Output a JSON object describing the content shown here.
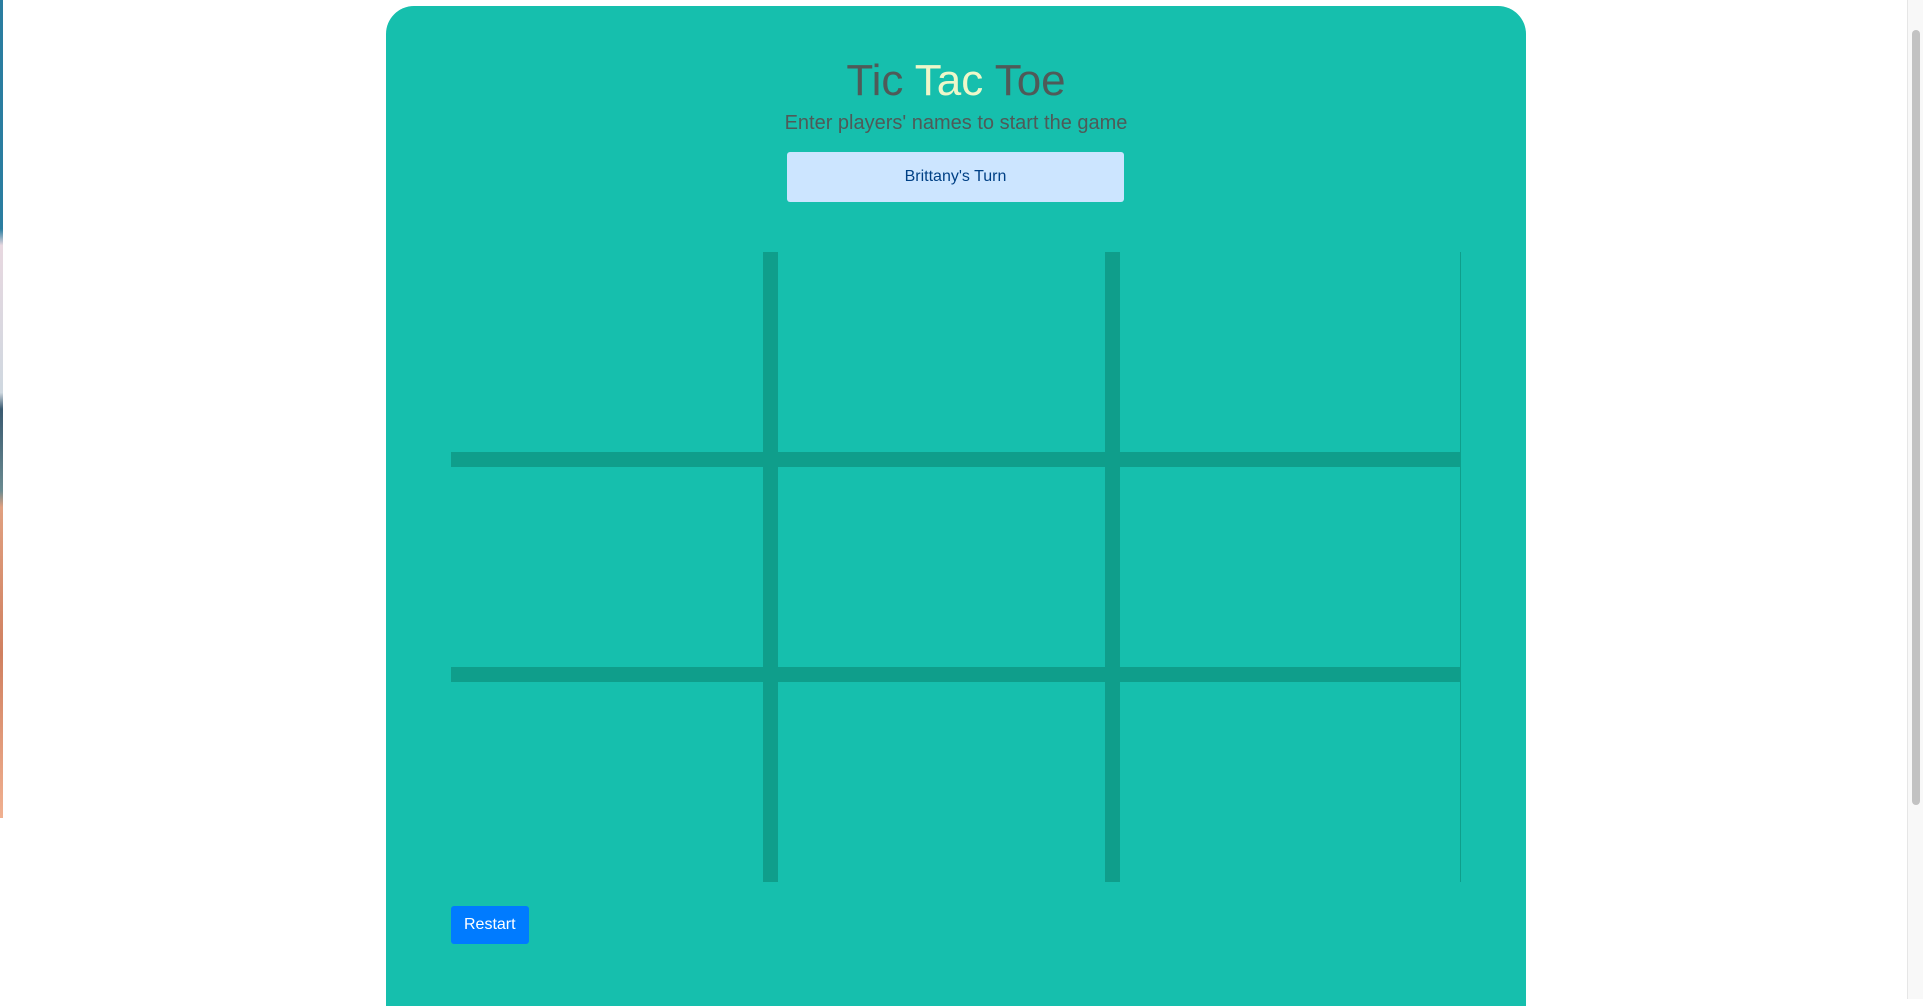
{
  "header": {
    "title_part1": "Tic ",
    "title_accent": "Tac",
    "title_part2": " Toe",
    "subtitle": "Enter players' names to start the game"
  },
  "status": {
    "text": "Brittany's Turn"
  },
  "board": {
    "cells": [
      "",
      "",
      "",
      "",
      "",
      "",
      "",
      "",
      ""
    ]
  },
  "controls": {
    "restart_label": "Restart"
  },
  "colors": {
    "panel": "#16bfad",
    "grid_lines": "#0f9e8b",
    "title_text": "#4f5a58",
    "title_accent": "#eef7c9",
    "status_bg": "#cce5ff",
    "status_text": "#004085",
    "button_bg": "#007bff"
  }
}
